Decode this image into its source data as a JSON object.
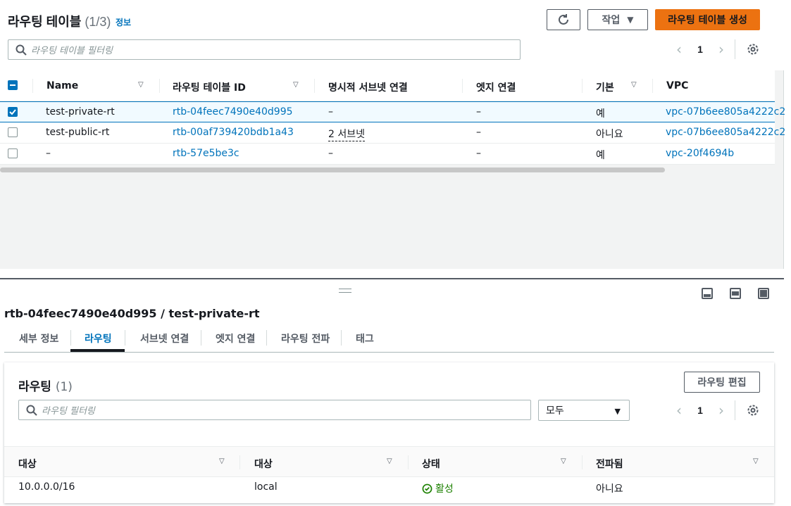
{
  "route_tables": {
    "title": "라우팅 테이블",
    "count": "(1/3)",
    "info_link": "정보",
    "actions_label": "작업",
    "create_label": "라우팅 테이블 생성",
    "search_placeholder": "라우팅 테이블 필터링",
    "page": "1",
    "columns": [
      "Name",
      "라우팅 테이블 ID",
      "명시적 서브넷 연결",
      "엣지 연결",
      "기본",
      "VPC"
    ],
    "rows": [
      {
        "selected": true,
        "name": "test-private-rt",
        "id": "rtb-04feec7490e40d995",
        "subnets": "–",
        "edge": "–",
        "main": "예",
        "vpc": "vpc-07b6ee805a4222c2"
      },
      {
        "selected": false,
        "name": "test-public-rt",
        "id": "rtb-00af739420bdb1a43",
        "subnets": "2 서브넷",
        "edge": "–",
        "main": "아니요",
        "vpc": "vpc-07b6ee805a4222c2"
      },
      {
        "selected": false,
        "name": "–",
        "id": "rtb-57e5be3c",
        "subnets": "–",
        "edge": "–",
        "main": "예",
        "vpc": "vpc-20f4694b"
      }
    ]
  },
  "detail": {
    "title": "rtb-04feec7490e40d995 / test-private-rt",
    "tabs": [
      "세부 정보",
      "라우팅",
      "서브넷 연결",
      "엣지 연결",
      "라우팅 전파",
      "태그"
    ],
    "active_tab": "라우팅",
    "routes": {
      "title": "라우팅",
      "count": "(1)",
      "edit_label": "라우팅 편집",
      "search_placeholder": "라우팅 필터링",
      "filter_value": "모두",
      "page": "1",
      "columns": [
        "대상",
        "대상",
        "상태",
        "전파됨"
      ],
      "rows": [
        {
          "destination": "10.0.0.0/16",
          "target": "local",
          "status": "활성",
          "propagated": "아니요"
        }
      ]
    }
  },
  "colors": {
    "accent": "#0073bb",
    "primary_button": "#ec7211",
    "active_status": "#1d8102"
  },
  "icons": [
    "refresh-icon",
    "caret-down-icon",
    "search-icon",
    "chevron-left-icon",
    "chevron-right-icon",
    "gear-icon",
    "sort-icon",
    "check-circle-icon",
    "panel-bottom-icon",
    "panel-side-icon",
    "panel-full-icon"
  ]
}
